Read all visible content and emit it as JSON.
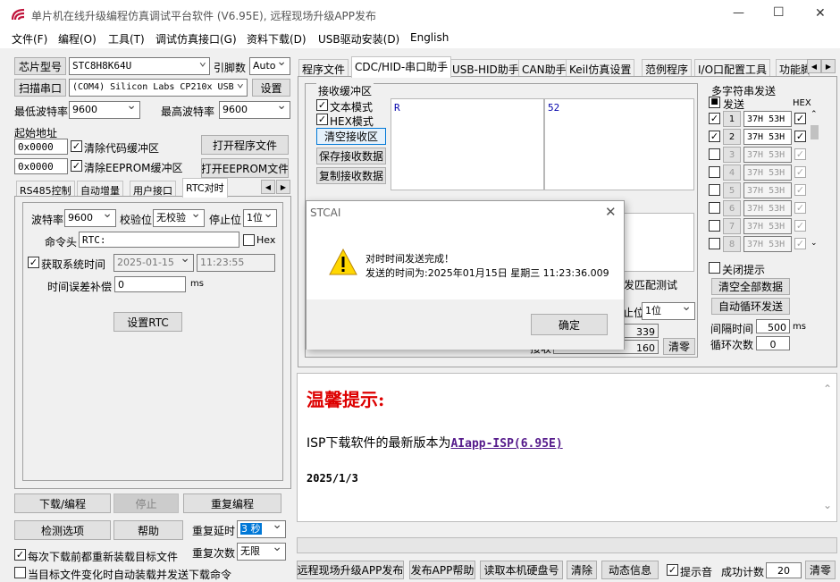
{
  "window": {
    "title": "单片机在线升级编程仿真调试平台软件 (V6.95E), 远程现场升级APP发布",
    "minimize": "—",
    "maximize": "☐",
    "close": "✕"
  },
  "menu": [
    "文件(F)",
    "编程(O)",
    "工具(T)",
    "调试仿真接口(G)",
    "资料下载(D)",
    "USB驱动安装(D)",
    "English"
  ],
  "left": {
    "chip_btn": "芯片型号",
    "chip": "STC8H8K64U",
    "pin_lbl": "引脚数",
    "pin": "Auto",
    "port_btn": "扫描串口",
    "port": "(COM4) Silicon Labs CP210x USB",
    "settings": "设置",
    "min_baud_lbl": "最低波特率",
    "min_baud": "9600",
    "max_baud_lbl": "最高波特率",
    "max_baud": "9600",
    "start_addr": "起始地址",
    "addr1": "0x0000",
    "clear_code": "清除代码缓冲区",
    "open_prog": "打开程序文件",
    "addr2": "0x0000",
    "clear_eep": "清除EEPROM缓冲区",
    "open_eep": "打开EEPROM文件",
    "tabs": [
      "RS485控制",
      "自动增量",
      "用户接口",
      "RTC对时"
    ],
    "rtc": {
      "baud_lbl": "波特率",
      "baud": "9600",
      "parity_lbl": "校验位",
      "parity": "无校验",
      "stop_lbl": "停止位",
      "stop": "1位",
      "cmd_lbl": "命令头",
      "cmd": "RTC:",
      "hex": "Hex",
      "get_time": "获取系统时间",
      "date": "2025-01-15",
      "time": "11:23:55",
      "comp_lbl": "时间误差补偿",
      "comp": "0",
      "ms": "ms",
      "set_btn": "设置RTC"
    },
    "download": "下载/编程",
    "stop": "停止",
    "reprog": "重复编程",
    "detect": "检测选项",
    "help": "帮助",
    "delay_lbl": "重复延时",
    "delay": "3 秒",
    "reload": "每次下载前都重新装载目标文件",
    "times_lbl": "重复次数",
    "times": "无限",
    "auto_load": "当目标文件变化时自动装载并发送下载命令"
  },
  "right": {
    "tabs": [
      "程序文件",
      "CDC/HID-串口助手",
      "USB-HID助手",
      "CAN助手",
      "Keil仿真设置",
      "范例程序",
      "I/O口配置工具",
      "功能脚"
    ],
    "recv_title": "接收缓冲区",
    "text_mode": "文本模式",
    "hex_mode": "HEX模式",
    "clear_recv": "清空接收区",
    "save_recv": "保存接收数据",
    "copy_recv": "复制接收数据",
    "recv_text": "R",
    "recv_hex": "52",
    "multi_title": "多字符串发送",
    "send": "发送",
    "hex": "HEX",
    "rows": [
      {
        "n": "1",
        "v": "37H 53H",
        "c": true,
        "h": true
      },
      {
        "n": "2",
        "v": "37H 53H",
        "c": true,
        "h": true
      },
      {
        "n": "3",
        "v": "37H 53H",
        "c": false,
        "h": true
      },
      {
        "n": "4",
        "v": "37H 53H",
        "c": false,
        "h": true
      },
      {
        "n": "5",
        "v": "37H 53H",
        "c": false,
        "h": true
      },
      {
        "n": "6",
        "v": "37H 53H",
        "c": false,
        "h": true
      },
      {
        "n": "7",
        "v": "37H 53H",
        "c": false,
        "h": true
      },
      {
        "n": "8",
        "v": "37H 53H",
        "c": false,
        "h": true
      }
    ],
    "close_tip": "关闭提示",
    "clear_all": "清空全部数据",
    "auto_loop": "自动循环发送",
    "interval_lbl": "间隔时间",
    "interval": "500",
    "ms": "ms",
    "loop_lbl": "循环次数",
    "loop": "0",
    "match_test": "发匹配测试",
    "stop_lbl": "止位",
    "stop": "1位",
    "cnt1": "339",
    "cnt2": "160",
    "clear_cnt": "清零",
    "recv_lbl": "接收"
  },
  "dialog": {
    "title": "STCAI",
    "line1": "对时时间发送完成！",
    "line2": "发送的时间为:2025年01月15日 星期三 11:23:36.009",
    "ok": "确定"
  },
  "notice": {
    "title": "温馨提示:",
    "line_pre": "ISP下载软件的最新版本为",
    "link": "AIapp-ISP(6.95E)",
    "date": "2025/1/3"
  },
  "bottom": {
    "upgrade": "远程现场升级APP发布",
    "publish": "发布APP帮助",
    "read_disk": "读取本机硬盘号",
    "clear": "清除",
    "dynamic": "动态信息",
    "beep": "提示音",
    "success_lbl": "成功计数",
    "success": "20",
    "zero": "清零"
  }
}
